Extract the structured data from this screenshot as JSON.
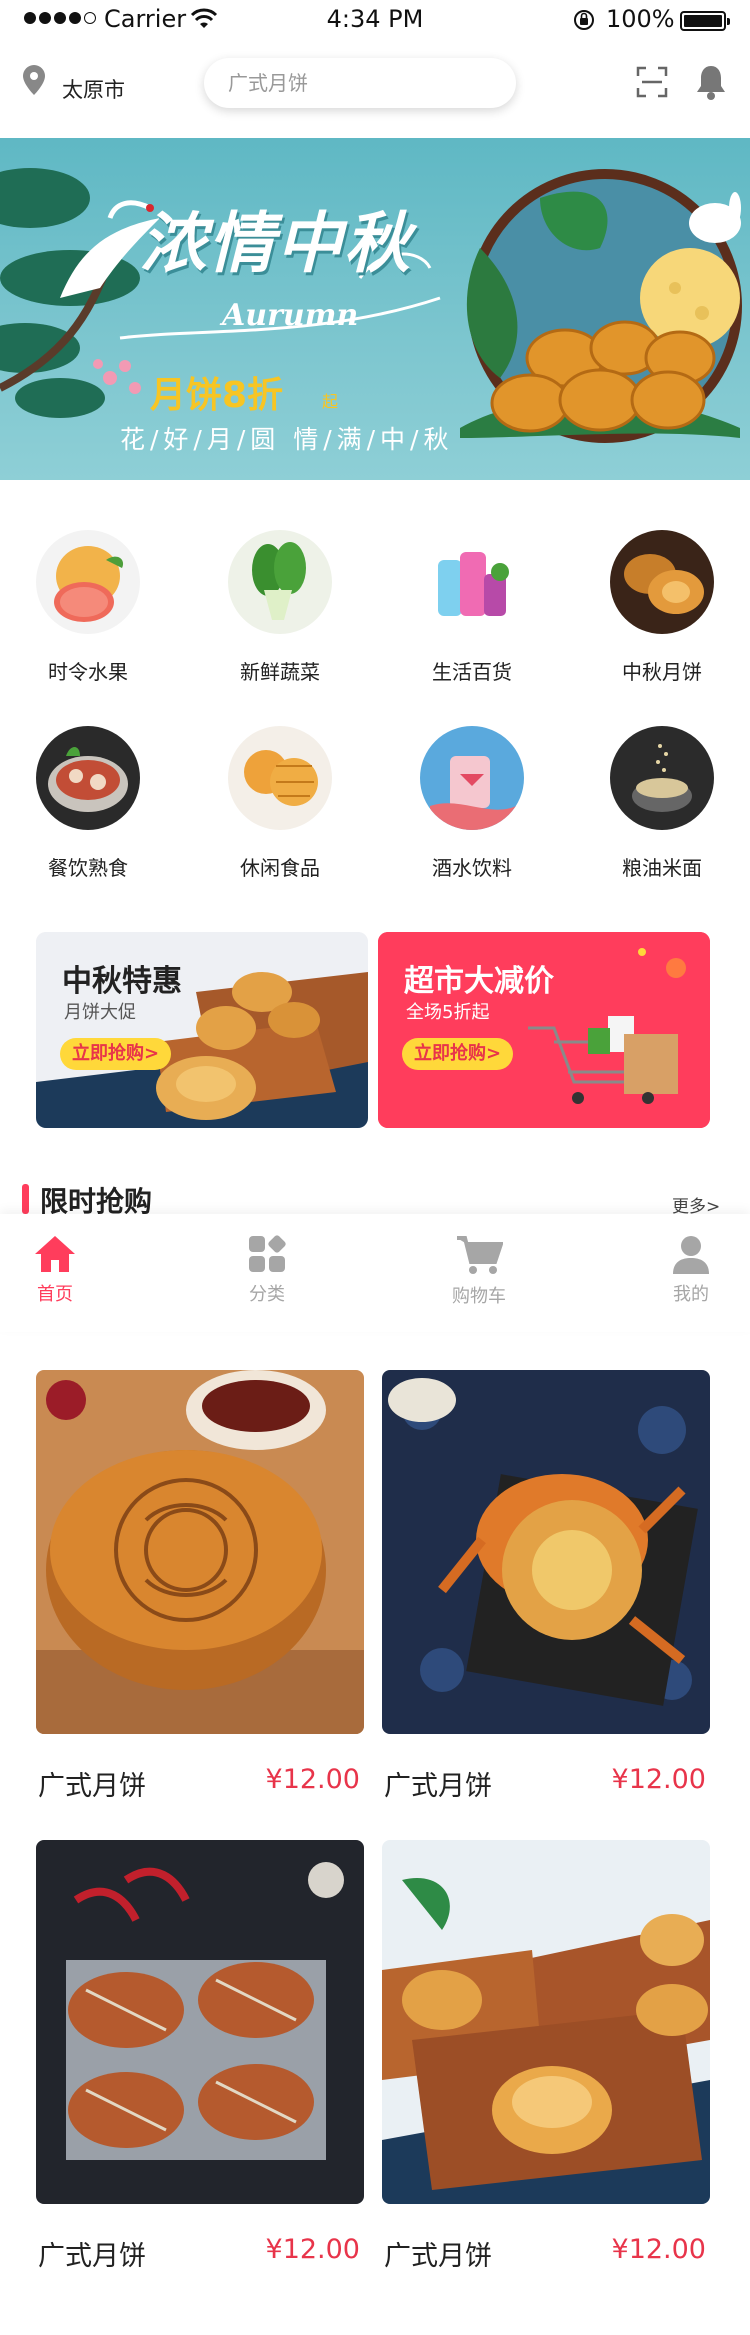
{
  "status_bar": {
    "carrier": "Carrier",
    "time": "4:34 PM",
    "battery": "100%"
  },
  "header": {
    "location": "太原市",
    "search_placeholder": "广式月饼"
  },
  "banner": {
    "title": "浓情中秋",
    "subtitle": "Aurumn",
    "promo": "月饼8折",
    "promo_suffix": "起",
    "slogan": "花/好/月/圆 情/满/中/秋"
  },
  "categories": [
    {
      "label": "时令水果",
      "icon": "grapefruit-image"
    },
    {
      "label": "新鲜蔬菜",
      "icon": "bok-choy-image"
    },
    {
      "label": "生活百货",
      "icon": "detergent-bottles-image"
    },
    {
      "label": "中秋月饼",
      "icon": "mooncake-image"
    },
    {
      "label": "餐饮熟食",
      "icon": "hotpot-image"
    },
    {
      "label": "休闲食品",
      "icon": "waffle-image"
    },
    {
      "label": "酒水饮料",
      "icon": "fruit-drink-image"
    },
    {
      "label": "粮油米面",
      "icon": "grain-bowl-image"
    }
  ],
  "promos": [
    {
      "title": "中秋特惠",
      "subtitle": "月饼大促",
      "button": "立即抢购>"
    },
    {
      "title": "超市大减价",
      "subtitle": "全场5折起",
      "button": "立即抢购>"
    }
  ],
  "flash_sale": {
    "title": "限时抢购",
    "more": "更多>"
  },
  "tabbar": [
    {
      "label": "首页",
      "icon": "home-icon",
      "active": true
    },
    {
      "label": "分类",
      "icon": "category-icon",
      "active": false
    },
    {
      "label": "购物车",
      "icon": "cart-icon",
      "active": false
    },
    {
      "label": "我的",
      "icon": "user-icon",
      "active": false
    }
  ],
  "products": [
    {
      "name": "广式月饼",
      "price": "¥12.00",
      "image": "mooncake-photo"
    },
    {
      "name": "广式月饼",
      "price": "¥12.00",
      "image": "crab-photo"
    },
    {
      "name": "广式月饼",
      "price": "¥12.00",
      "image": "tied-crabs-photo"
    },
    {
      "name": "广式月饼",
      "price": "¥12.00",
      "image": "mooncakes-on-trays-photo"
    }
  ],
  "colors": {
    "accent": "#ff3d5c",
    "price": "#e8344a",
    "banner_bg": "#6bbec8",
    "promo_red": "#ff3d5c",
    "promo_button": "#ffd83a"
  }
}
